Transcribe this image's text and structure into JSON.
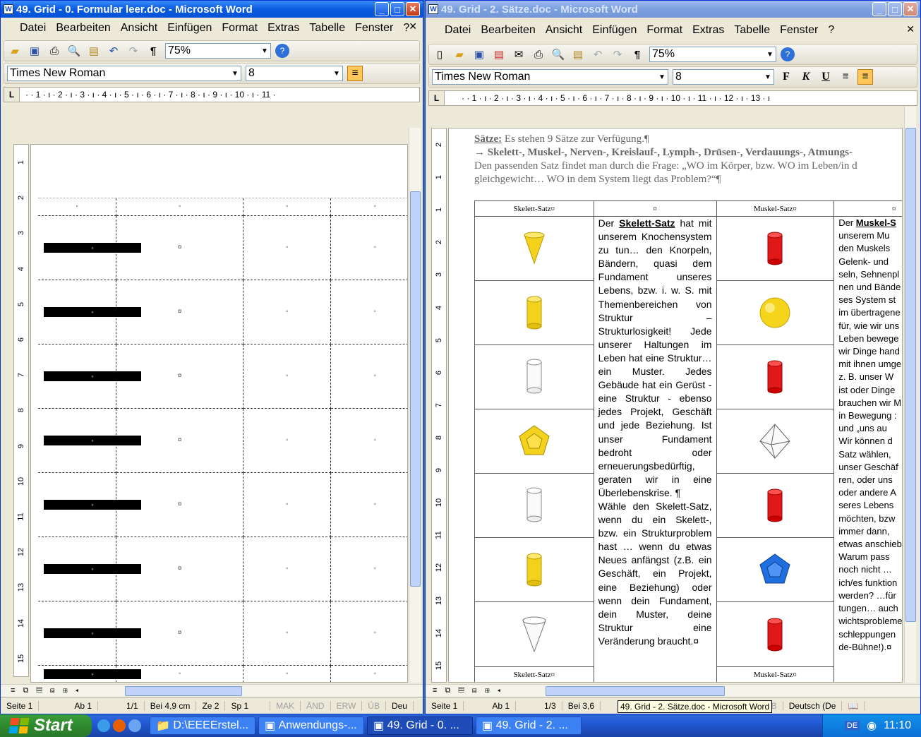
{
  "left_window": {
    "title": "49. Grid - 0. Formular leer.doc - Microsoft Word",
    "menu": [
      "Datei",
      "Bearbeiten",
      "Ansicht",
      "Einfügen",
      "Format",
      "Extras",
      "Tabelle",
      "Fenster",
      "?"
    ],
    "zoom": "75%",
    "font_name": "Times New Roman",
    "font_size": "8",
    "ruler_h": "· · 1 · ı · 2 · ı · 3 · ı · 4 · ı · 5 · ı · 6 · ı · 7 · ı · 8 · ı · 9 · ı · 10 · ı · 11 ·",
    "ruler_v": [
      "1",
      "2",
      "3",
      "4",
      "5",
      "6",
      "7",
      "8",
      "9",
      "10",
      "11",
      "12",
      "13",
      "14",
      "15"
    ],
    "cell_mark": "◦",
    "cell_mark_alt": "¤",
    "status": {
      "seite": "Seite 1",
      "ab": "Ab 1",
      "pages": "1/1",
      "bei": "Bei 4,9 cm",
      "ze": "Ze 2",
      "sp": "Sp 1",
      "mak": "MAK",
      "aend": "ÄND",
      "erw": "ERW",
      "ueb": "ÜB",
      "lang": "Deu"
    }
  },
  "right_window": {
    "title": "49. Grid - 2. Sätze.doc - Microsoft Word",
    "menu": [
      "Datei",
      "Bearbeiten",
      "Ansicht",
      "Einfügen",
      "Format",
      "Extras",
      "Tabelle",
      "Fenster",
      "?"
    ],
    "zoom": "75%",
    "font_name": "Times New Roman",
    "font_size": "8",
    "bold_label": "F",
    "italic_label": "K",
    "underline_label": "U",
    "ruler_h": "· · 1 · ı · 2 · ı · 3 · ı · 4 · ı · 5 · ı · 6 · ı · 7 · ı · 8 · ı · 9 · ı · 10 · ı · 11 · ı · 12 · ı · 13 · ı",
    "ruler_v": [
      "2",
      "1",
      "1",
      "2",
      "3",
      "4",
      "5",
      "6",
      "7",
      "8",
      "9",
      "10",
      "11",
      "12",
      "13",
      "14",
      "15"
    ],
    "intro_label": "Sätze:",
    "intro_text": " Es stehen 9 Sätze zur Verfügung.¶",
    "intro_line2": "→ Skelett-, Muskel-, Nerven-, Kreislauf-, Lymph-, Drüsen-, Verdauungs-, Atmungs-",
    "intro_line3": "Den passenden Satz findet man durch die Frage: „WO im Körper, bzw. WO im Leben/in d",
    "intro_line4": "gleichgewicht… WO in dem System liegt das Problem?“¶",
    "col1_head": "Skelett-Satz¤",
    "col2_head": "¤",
    "col3_head": "Muskel-Satz¤",
    "col4_head": "¤",
    "col1_foot": "Skelett-Satz¤",
    "col3_foot": "Muskel-Satz¤",
    "skelett_text_lead": "Der ",
    "skelett_text_name": "Skelett-Satz",
    "skelett_text": " hat mit unserem Knochensystem zu tun… den Knorpeln, Bändern, quasi dem Fundament unseres Lebens, bzw. i. w. S. mit Themenbereichen von Struktur – Strukturlosigkeit! Jede unserer Haltungen im Leben hat eine Struktur… ein Muster. Jedes Gebäude hat ein Gerüst - eine Struktur - ebenso jedes Projekt, Geschäft und jede Beziehung. Ist unser Fundament bedroht oder erneuerungsbedürftig, geraten wir in eine Überlebenskrise. ¶",
    "skelett_text2": "Wähle den Skelett-Satz, wenn du ein Skelett-, bzw. ein Strukturproblem hast … wenn du etwas Neues anfängst (z.B. ein Geschäft, ein Projekt, eine Beziehung) oder wenn dein Fundament, dein Muster, deine Struktur eine Veränderung braucht.¤",
    "muskel_text_lead": "Der ",
    "muskel_text_name": "Muskel-S",
    "muskel_lines": [
      "unserem Mu",
      "den Muskels",
      "Gelenk- und",
      "seln, Sehnenpl",
      "nen und Bände",
      "ses System st",
      "im übertragene",
      "für, wie wir uns",
      "Leben bewege",
      "wir Dinge hand",
      "mit ihnen umge",
      "z. B. unser W",
      "ist oder Dinge",
      "brauchen wir M",
      "in Bewegung :",
      "und „uns au",
      "Wir können d",
      "Satz wählen,",
      "unser Geschäf",
      "ren, oder uns",
      "oder andere A",
      "seres Lebens",
      "möchten, bzw",
      "immer dann,",
      "etwas anschieb",
      "Warum pass",
      "noch nicht …",
      "ich/es funktion",
      "werden? …für",
      "tungen… auch",
      "wichtsprobleme",
      "schleppungen",
      "de-Bühne!).¤"
    ],
    "tooltip": "49. Grid - 2. Sätze.doc - Microsoft Word",
    "status": {
      "seite": "Seite 1",
      "ab": "Ab 1",
      "pages": "1/3",
      "bei": "Bei 3,6",
      "ueb": "ÜB",
      "lang": "Deutsch (De"
    }
  },
  "taskbar": {
    "start": "Start",
    "tasks": [
      "D:\\EEEErstel...",
      "Anwendungs-...",
      "49. Grid - 0. ...",
      "49. Grid - 2. ..."
    ],
    "lang": "DE",
    "clock": "11:10"
  }
}
